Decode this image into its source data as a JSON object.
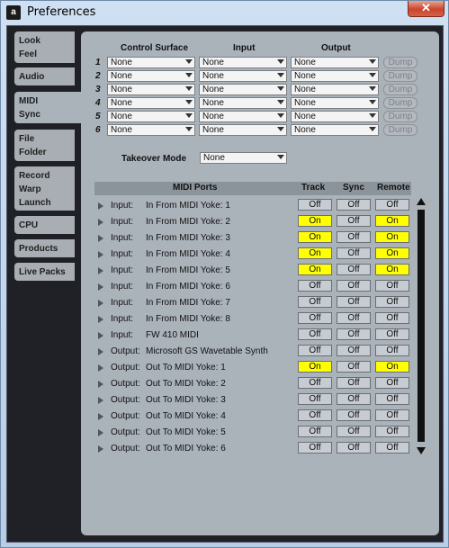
{
  "window": {
    "title": "Preferences",
    "close_label": "✕",
    "icon_glyph": "a"
  },
  "tabs": [
    {
      "lines": [
        "Look",
        "Feel"
      ]
    },
    {
      "lines": [
        "Audio"
      ]
    },
    {
      "lines": [
        "MIDI",
        "Sync"
      ]
    },
    {
      "lines": [
        "File",
        "Folder"
      ]
    },
    {
      "lines": [
        "Record",
        "Warp",
        "Launch"
      ]
    },
    {
      "lines": [
        "CPU"
      ]
    },
    {
      "lines": [
        "Products"
      ]
    },
    {
      "lines": [
        "Live Packs"
      ]
    }
  ],
  "surfaces": {
    "headers": {
      "control": "Control Surface",
      "input": "Input",
      "output": "Output"
    },
    "rows": [
      {
        "num": "1",
        "control": "None",
        "input": "None",
        "output": "None",
        "dump": "Dump"
      },
      {
        "num": "2",
        "control": "None",
        "input": "None",
        "output": "None",
        "dump": "Dump"
      },
      {
        "num": "3",
        "control": "None",
        "input": "None",
        "output": "None",
        "dump": "Dump"
      },
      {
        "num": "4",
        "control": "None",
        "input": "None",
        "output": "None",
        "dump": "Dump"
      },
      {
        "num": "5",
        "control": "None",
        "input": "None",
        "output": "None",
        "dump": "Dump"
      },
      {
        "num": "6",
        "control": "None",
        "input": "None",
        "output": "None",
        "dump": "Dump"
      }
    ]
  },
  "takeover": {
    "label": "Takeover Mode",
    "value": "None"
  },
  "ports": {
    "headers": {
      "ports": "MIDI Ports",
      "track": "Track",
      "sync": "Sync",
      "remote": "Remote"
    },
    "rows": [
      {
        "kind": "Input:",
        "name": "In From MIDI Yoke:  1",
        "track": "Off",
        "sync": "Off",
        "remote": "Off"
      },
      {
        "kind": "Input:",
        "name": "In From MIDI Yoke:  2",
        "track": "On",
        "sync": "Off",
        "remote": "On"
      },
      {
        "kind": "Input:",
        "name": "In From MIDI Yoke:  3",
        "track": "On",
        "sync": "Off",
        "remote": "On"
      },
      {
        "kind": "Input:",
        "name": "In From MIDI Yoke:  4",
        "track": "On",
        "sync": "Off",
        "remote": "On"
      },
      {
        "kind": "Input:",
        "name": "In From MIDI Yoke:  5",
        "track": "On",
        "sync": "Off",
        "remote": "On"
      },
      {
        "kind": "Input:",
        "name": "In From MIDI Yoke:  6",
        "track": "Off",
        "sync": "Off",
        "remote": "Off"
      },
      {
        "kind": "Input:",
        "name": "In From MIDI Yoke:  7",
        "track": "Off",
        "sync": "Off",
        "remote": "Off"
      },
      {
        "kind": "Input:",
        "name": "In From MIDI Yoke:  8",
        "track": "Off",
        "sync": "Off",
        "remote": "Off"
      },
      {
        "kind": "Input:",
        "name": "FW 410 MIDI",
        "track": "Off",
        "sync": "Off",
        "remote": "Off"
      },
      {
        "kind": "Output:",
        "name": "Microsoft GS Wavetable Synth",
        "track": "Off",
        "sync": "Off",
        "remote": "Off"
      },
      {
        "kind": "Output:",
        "name": "Out To MIDI Yoke:  1",
        "track": "On",
        "sync": "Off",
        "remote": "On"
      },
      {
        "kind": "Output:",
        "name": "Out To MIDI Yoke:  2",
        "track": "Off",
        "sync": "Off",
        "remote": "Off"
      },
      {
        "kind": "Output:",
        "name": "Out To MIDI Yoke:  3",
        "track": "Off",
        "sync": "Off",
        "remote": "Off"
      },
      {
        "kind": "Output:",
        "name": "Out To MIDI Yoke:  4",
        "track": "Off",
        "sync": "Off",
        "remote": "Off"
      },
      {
        "kind": "Output:",
        "name": "Out To MIDI Yoke:  5",
        "track": "Off",
        "sync": "Off",
        "remote": "Off"
      },
      {
        "kind": "Output:",
        "name": "Out To MIDI Yoke:  6",
        "track": "Off",
        "sync": "Off",
        "remote": "Off"
      }
    ]
  },
  "colors": {
    "on": "#ffff00",
    "off": "#c6ccd2",
    "panel": "#aab2ba",
    "background": "#1f2126"
  }
}
